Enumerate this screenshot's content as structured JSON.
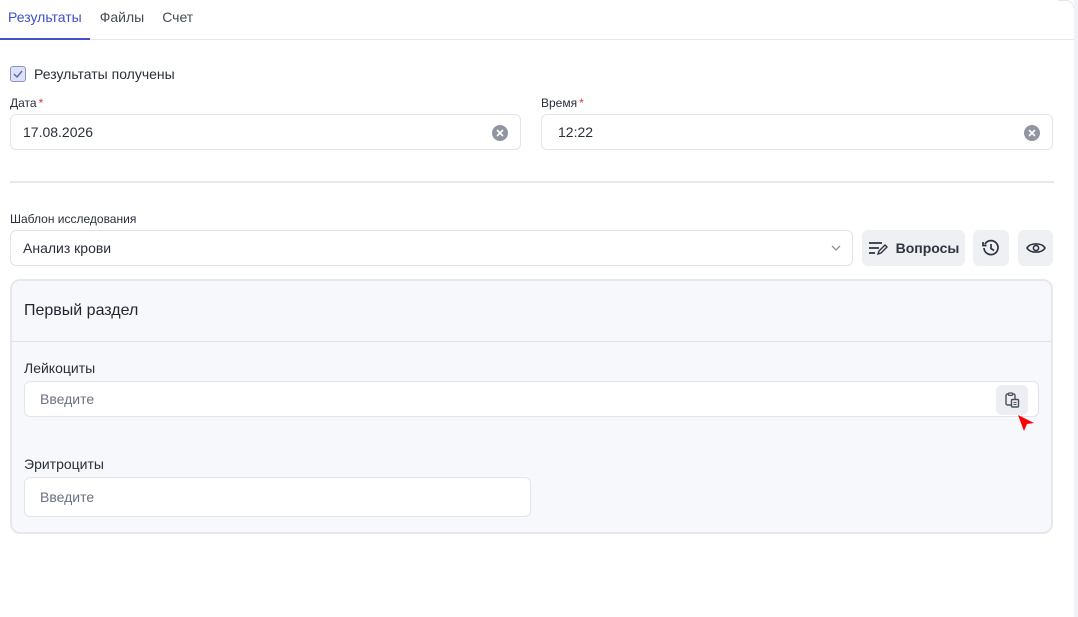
{
  "tabs": [
    {
      "label": "Результаты",
      "active": true
    },
    {
      "label": "Файлы",
      "active": false
    },
    {
      "label": "Счет",
      "active": false
    }
  ],
  "results_received": {
    "label": "Результаты получены",
    "checked": true
  },
  "date": {
    "label": "Дата",
    "required_mark": "*",
    "value": "17.08.2026"
  },
  "time": {
    "label": "Время",
    "required_mark": "*",
    "value": "12:22"
  },
  "template": {
    "label": "Шаблон исследования",
    "value": "Анализ крови"
  },
  "buttons": {
    "questions_label": "Вопросы"
  },
  "section": {
    "title": "Первый раздел",
    "fields": [
      {
        "label": "Лейкоциты",
        "placeholder": "Введите"
      },
      {
        "label": "Эритроциты",
        "placeholder": "Введите"
      }
    ]
  },
  "colors": {
    "accent": "#4353c6",
    "required": "#e0353d",
    "cursor": "#ff0000"
  }
}
